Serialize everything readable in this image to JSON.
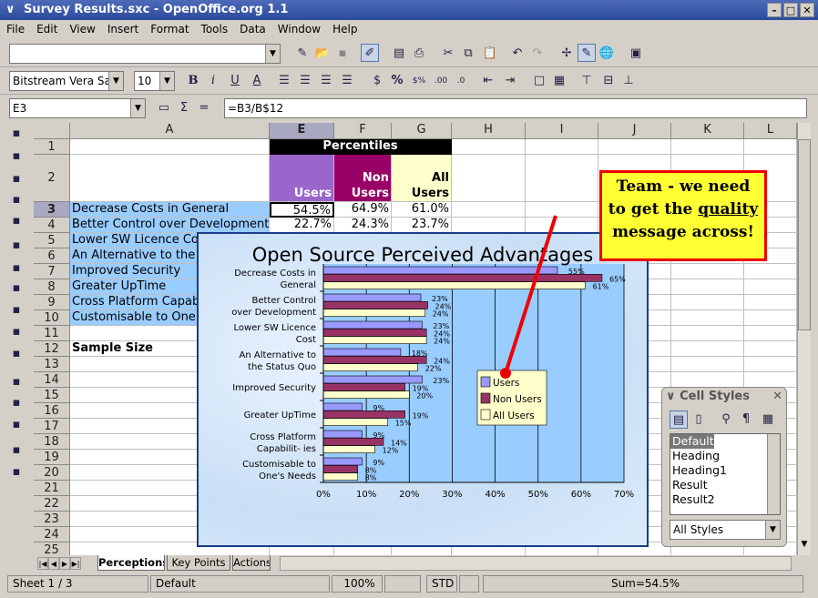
{
  "window": {
    "title": "Survey Results.sxc - OpenOffice.org 1.1"
  },
  "menu": [
    "File",
    "Edit",
    "View",
    "Insert",
    "Format",
    "Tools",
    "Data",
    "Window",
    "Help"
  ],
  "toolbar": {
    "url_value": "",
    "font_name": "Bitstream Vera Sa",
    "font_size": "10",
    "bold": "B",
    "italic": "i",
    "underline": "U"
  },
  "formula_bar": {
    "cell_ref": "E3",
    "sigma": "Σ",
    "equals": "=",
    "formula": "=B3/B$12"
  },
  "columns": [
    "A",
    "E",
    "F",
    "G",
    "H",
    "I",
    "J",
    "K",
    "L"
  ],
  "selected_column": "E",
  "selected_row": 3,
  "sheet": {
    "percentiles_header": "Percentiles",
    "col_headers": [
      {
        "label": "Users",
        "color": "#9966cc"
      },
      {
        "label": "Non Users",
        "color": "#990066"
      },
      {
        "label": "All Users",
        "color": "#ffffcc"
      }
    ],
    "row_labels": [
      "Decrease Costs in General",
      "Better Control over Development",
      "Lower SW Licence Cost",
      "An Alternative to the Status Quo",
      "Improved Security",
      "Greater UpTime",
      "Cross Platform Capabilities",
      "Customisable to One's Needs"
    ],
    "values": [
      [
        "54.5%",
        "64.9%",
        "61.0%"
      ],
      [
        "22.7%",
        "24.3%",
        "23.7%"
      ]
    ],
    "sample_size_label": "Sample Size",
    "label_fill": "#99ccff"
  },
  "chart_data": {
    "type": "bar",
    "orientation": "horizontal",
    "title": "Open Source Perceived Advantages",
    "categories": [
      "Decrease Costs in General",
      "Better Control over Development",
      "Lower SW Licence Cost",
      "An Alternative to the Status Quo",
      "Improved Security",
      "Greater UpTime",
      "Cross Platform Capabilit- ies",
      "Customisable to One's Needs"
    ],
    "series": [
      {
        "name": "Users",
        "color": "#9999ff",
        "values": [
          54.5,
          22.7,
          23,
          18,
          23,
          9,
          9,
          9
        ],
        "labels": [
          "55%",
          "23%",
          "23%",
          "18%",
          "23%",
          "9%",
          "9%",
          "9%"
        ]
      },
      {
        "name": "Non Users",
        "color": "#993366",
        "values": [
          64.9,
          24.3,
          24,
          24,
          19,
          19,
          14,
          8
        ],
        "labels": [
          "65%",
          "24%",
          "24%",
          "24%",
          "19%",
          "19%",
          "14%",
          "8%"
        ]
      },
      {
        "name": "All Users",
        "color": "#ffffcc",
        "values": [
          61.0,
          23.7,
          24,
          22,
          20,
          15,
          12,
          8
        ],
        "labels": [
          "61%",
          "24%",
          "24%",
          "22%",
          "20%",
          "15%",
          "12%",
          "8%"
        ]
      }
    ],
    "xlim": [
      0,
      70
    ],
    "xticks": [
      "0%",
      "10%",
      "20%",
      "30%",
      "40%",
      "50%",
      "60%",
      "70%"
    ],
    "grid": true,
    "legend": "center-right"
  },
  "callout": {
    "line1": "Team - we need",
    "line2a": "to get the ",
    "line2b": "quality",
    "line3": "message across!"
  },
  "cell_styles": {
    "title": "Cell Styles",
    "items": [
      "Default",
      "Heading",
      "Heading1",
      "Result",
      "Result2"
    ],
    "selected": "Default",
    "filter": "All Styles"
  },
  "tabs": [
    {
      "label": "Perceptions",
      "active": true
    },
    {
      "label": "Key Points"
    },
    {
      "label": "Actions"
    }
  ],
  "status": {
    "sheet": "Sheet 1 / 3",
    "style": "Default",
    "zoom": "100%",
    "mode": "STD",
    "sum": "Sum=54.5%"
  }
}
